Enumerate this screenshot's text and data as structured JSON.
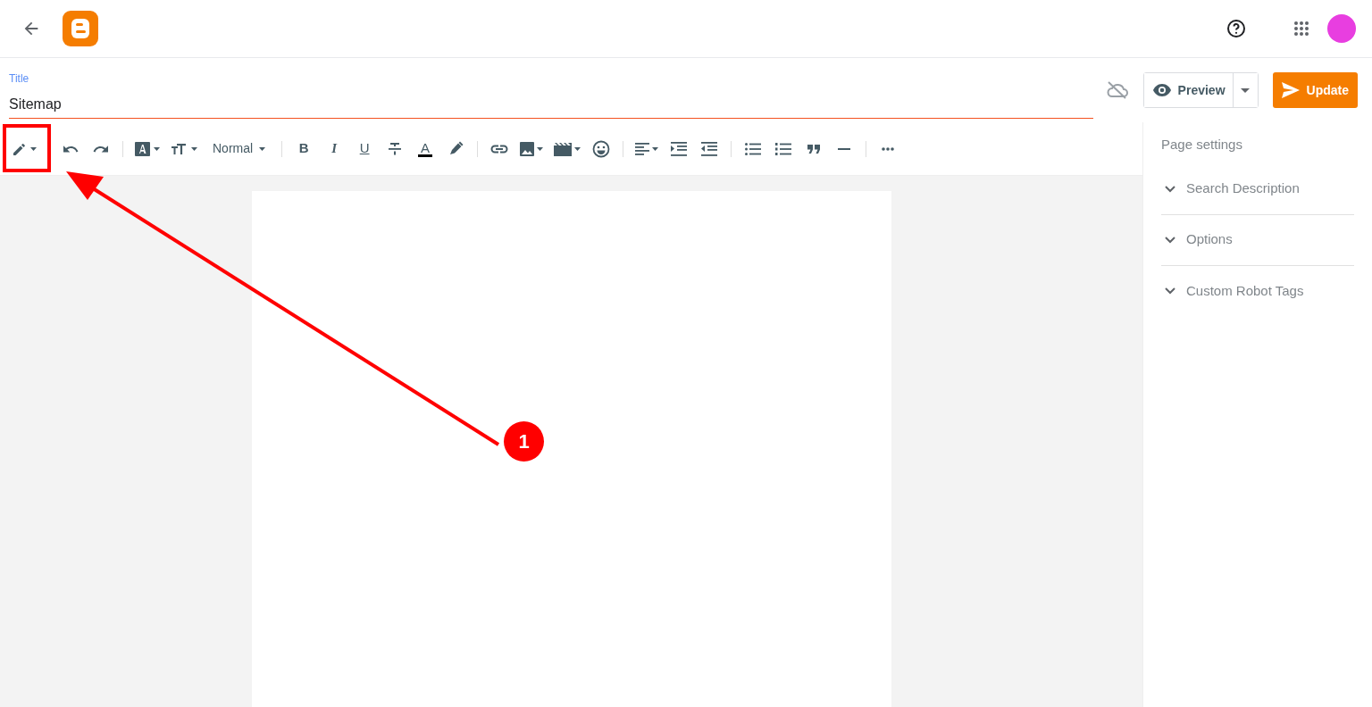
{
  "title_field": {
    "label": "Title",
    "value": "Sitemap"
  },
  "actions": {
    "preview": "Preview",
    "update": "Update"
  },
  "toolbar": {
    "paragraph_style": "Normal",
    "bold": "B",
    "italic": "I",
    "underline": "U",
    "text_color": "A"
  },
  "sidebar": {
    "heading": "Page settings",
    "sections": [
      {
        "label": "Search Description",
        "expanded": false
      },
      {
        "label": "Options",
        "expanded": false
      },
      {
        "label": "Custom Robot Tags",
        "expanded": false
      }
    ]
  },
  "annotation": {
    "number": "1"
  }
}
